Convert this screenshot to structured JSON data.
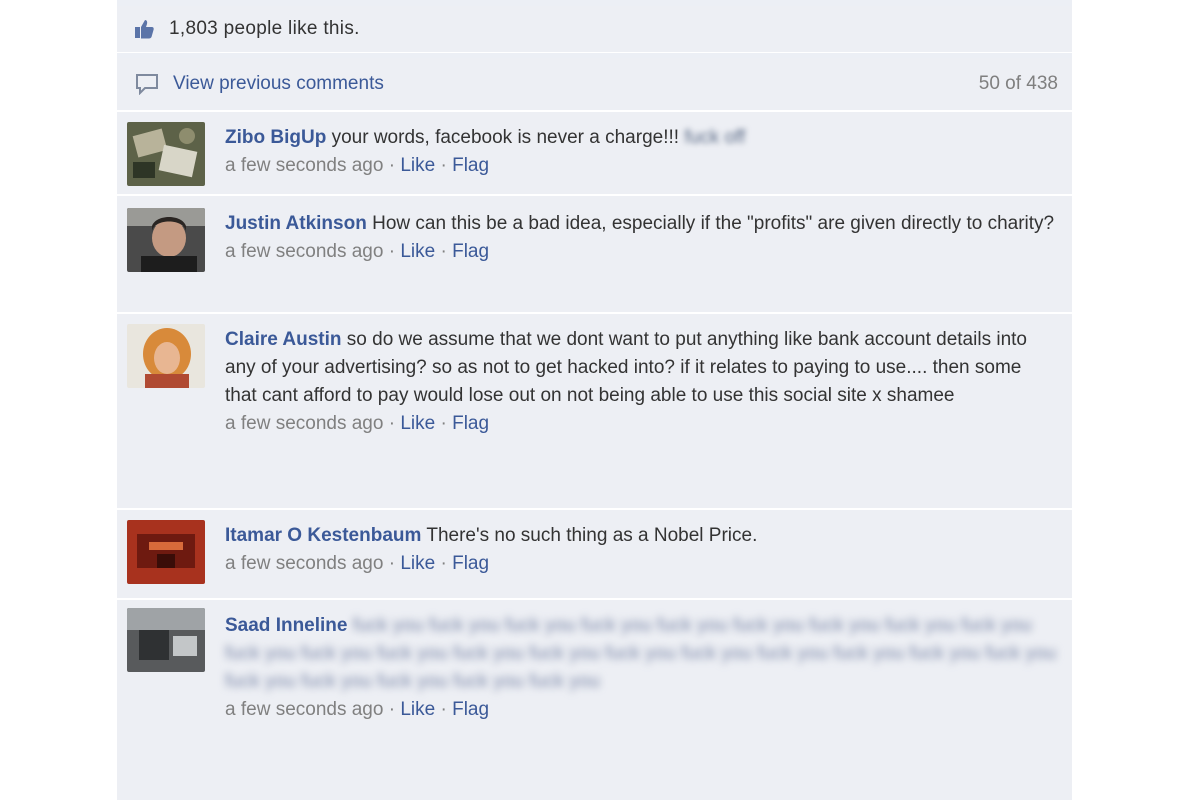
{
  "likes": {
    "text": "1,803 people like this."
  },
  "previous": {
    "link": "View previous comments",
    "count": "50 of 438"
  },
  "comments": [
    {
      "author": "Zibo BigUp",
      "text": "your words, facebook is never a charge!!!",
      "blurred": "fuck off",
      "time": "a few seconds ago",
      "like": "Like",
      "flag": "Flag",
      "sep": "·"
    },
    {
      "author": "Justin Atkinson",
      "text": "How can this be a bad idea, especially if the \"profits\" are given directly to charity?",
      "time": "a few seconds ago",
      "like": "Like",
      "flag": "Flag",
      "sep": "·"
    },
    {
      "author": "Claire Austin",
      "text": "so do we assume that we dont want to put anything like bank account details into any of your advertising? so as not to get hacked into? if it relates to paying to use.... then some that cant afford to pay would lose out on not being able to use this social site x shamee",
      "time": "a few seconds ago",
      "like": "Like",
      "flag": "Flag",
      "sep": "·"
    },
    {
      "author": "Itamar O Kestenbaum",
      "text": "There's no such thing as a Nobel Price.",
      "time": "a few seconds ago",
      "like": "Like",
      "flag": "Flag",
      "sep": "·"
    },
    {
      "author": "Saad Inneline",
      "blurred": "fuck you fuck you fuck you fuck you fuck you fuck you fuck you fuck you fuck you fuck you fuck you fuck you fuck you fuck you fuck you fuck you fuck you fuck you fuck you fuck you fuck you fuck you fuck you fuck you fuck you",
      "time": "a few seconds ago",
      "like": "Like",
      "flag": "Flag",
      "sep": "·"
    }
  ],
  "colors": {
    "link": "#3b5998",
    "background": "#edeff4",
    "meta": "#808080"
  },
  "icons": {
    "likes": "thumbs-up-icon",
    "previous": "comment-bubble-icon"
  }
}
